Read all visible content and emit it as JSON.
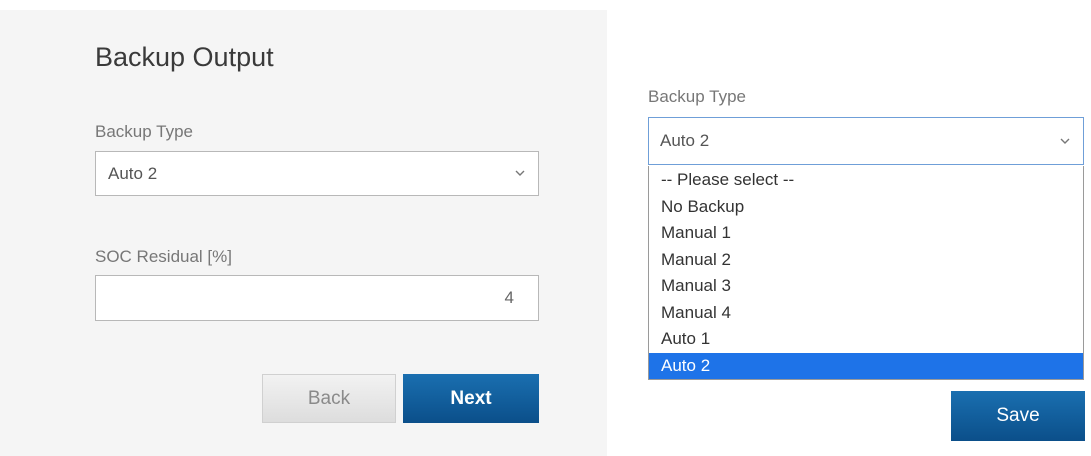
{
  "form": {
    "title": "Backup Output",
    "backup_type": {
      "label": "Backup Type",
      "value": "Auto 2"
    },
    "soc_residual": {
      "label": "SOC Residual [%]",
      "value": "4"
    },
    "back_label": "Back",
    "next_label": "Next"
  },
  "dropdown_view": {
    "label": "Backup Type",
    "value": "Auto 2",
    "selected_option": "Auto 2",
    "options": [
      "-- Please select --",
      "No Backup",
      "Manual 1",
      "Manual 2",
      "Manual 3",
      "Manual 4",
      "Auto 1",
      "Auto 2"
    ],
    "save_label": "Save"
  },
  "icons": {
    "select_chevron": "chevron-down-icon"
  },
  "colors": {
    "primary_button": "#0b4f8a",
    "selected_option": "#1e73e8",
    "panel_background": "#f5f5f5"
  }
}
